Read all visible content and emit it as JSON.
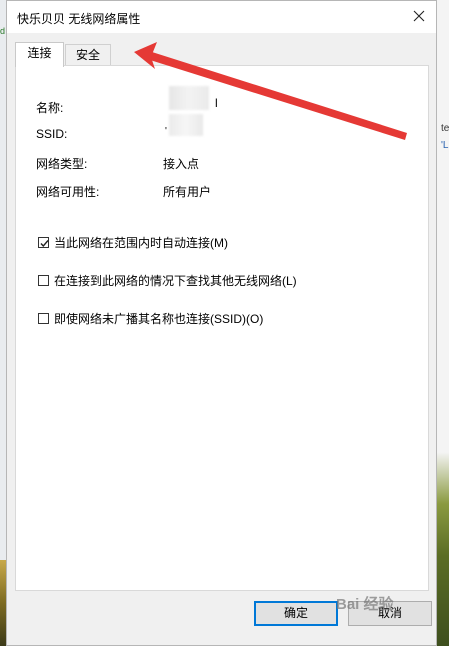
{
  "background": {
    "right_text_1": "te",
    "right_text_2": "'L",
    "top_left_text": "d"
  },
  "dialog": {
    "title": "快乐贝贝 无线网络属性",
    "tabs": [
      {
        "label": "连接",
        "active": true
      },
      {
        "label": "安全",
        "active": false
      }
    ],
    "properties": [
      {
        "label": "名称:",
        "value": ""
      },
      {
        "label": "SSID:",
        "value": ""
      },
      {
        "label": "网络类型:",
        "value": "接入点"
      },
      {
        "label": "网络可用性:",
        "value": "所有用户"
      }
    ],
    "name_value_edge": "l",
    "ssid_value_edge": "'",
    "checkboxes": [
      {
        "label": "当此网络在范围内时自动连接(M)",
        "checked": true
      },
      {
        "label": "在连接到此网络的情况下查找其他无线网络(L)",
        "checked": false
      },
      {
        "label": "即使网络未广播其名称也连接(SSID)(O)",
        "checked": false
      }
    ],
    "ok_label": "确定",
    "cancel_label": "取消"
  },
  "watermark": "Bai 经验",
  "colors": {
    "accent": "#0078d7",
    "arrow": "#e53935",
    "panel": "#ffffff",
    "dialog_bg": "#f0f0f0"
  },
  "icons": {
    "close": "close-icon",
    "check": "checkmark-icon",
    "arrow": "annotation-arrow"
  }
}
